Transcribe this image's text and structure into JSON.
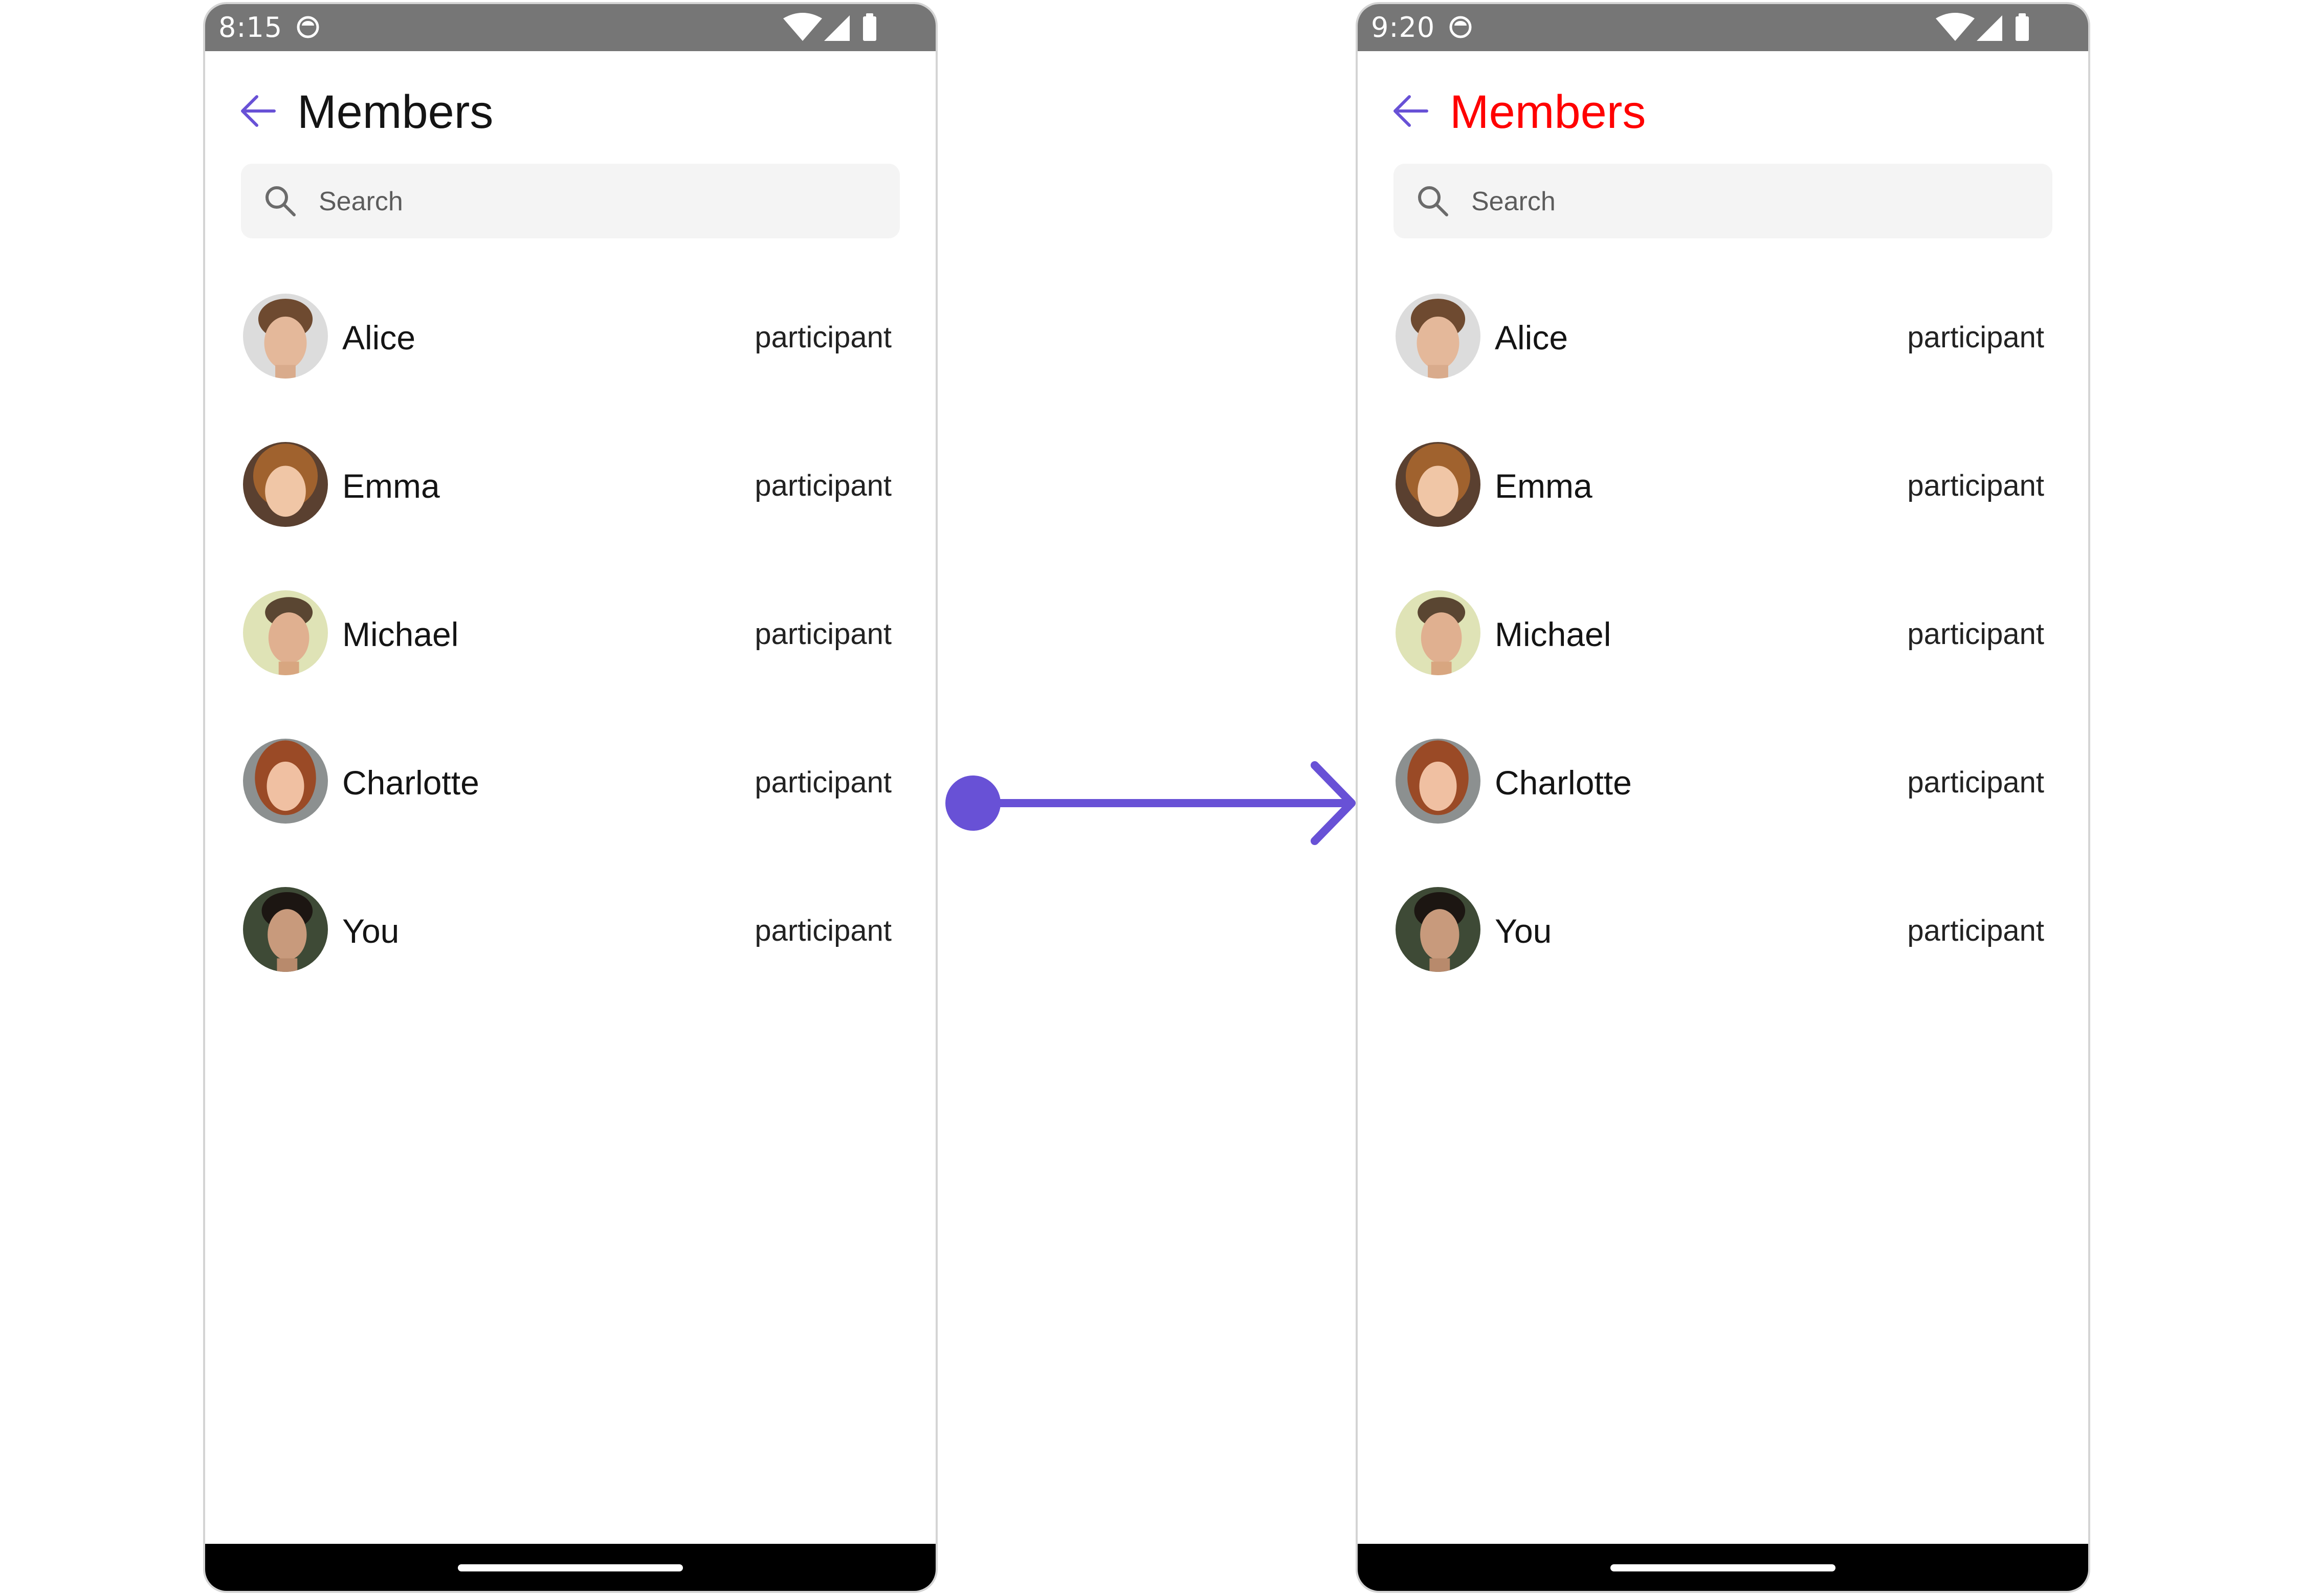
{
  "colors": {
    "accent": "#6851d6",
    "title_default": "#141414",
    "title_custom": "#ff0000",
    "status_bar": "#767676",
    "search_bg": "#f4f4f4"
  },
  "icons": {
    "back": "arrow-left-icon",
    "search": "search-icon",
    "status_app": "app-notification-icon",
    "wifi": "wifi-icon",
    "signal": "cellular-signal-icon",
    "battery": "battery-icon",
    "transition": "right-arrow-connector-icon"
  },
  "screens": [
    {
      "status_time": "8:15",
      "title": "Members",
      "search": {
        "placeholder": "Search"
      },
      "members": [
        {
          "name": "Alice",
          "role": "participant"
        },
        {
          "name": "Emma",
          "role": "participant"
        },
        {
          "name": "Michael",
          "role": "participant"
        },
        {
          "name": "Charlotte",
          "role": "participant"
        },
        {
          "name": "You",
          "role": "participant"
        }
      ]
    },
    {
      "status_time": "9:20",
      "title": "Members",
      "search": {
        "placeholder": "Search"
      },
      "members": [
        {
          "name": "Alice",
          "role": "participant"
        },
        {
          "name": "Emma",
          "role": "participant"
        },
        {
          "name": "Michael",
          "role": "participant"
        },
        {
          "name": "Charlotte",
          "role": "participant"
        },
        {
          "name": "You",
          "role": "participant"
        }
      ]
    }
  ]
}
